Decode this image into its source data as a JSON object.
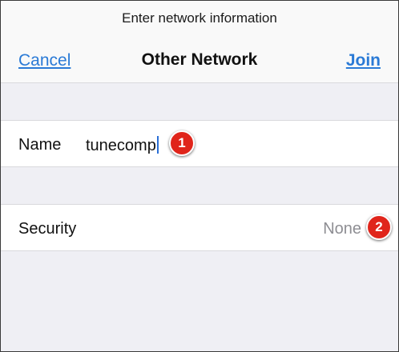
{
  "navbar": {
    "prompt": "Enter network information",
    "cancel_label": "Cancel",
    "title": "Other Network",
    "join_label": "Join"
  },
  "form": {
    "name": {
      "label": "Name",
      "value": "tunecomp"
    },
    "security": {
      "label": "Security",
      "value": "None"
    }
  },
  "annotations": {
    "badge_1": "1",
    "badge_2": "2"
  },
  "colors": {
    "link": "#2a7ad6",
    "background": "#efeff4",
    "badge": "#e0251b"
  }
}
